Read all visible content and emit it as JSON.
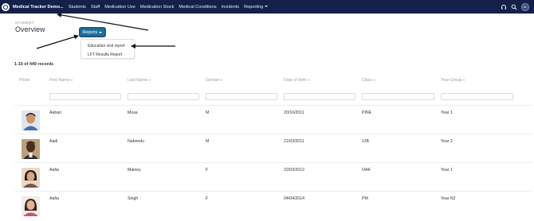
{
  "navbar": {
    "brand": "Medical Tracker Demo...",
    "links": [
      "Students",
      "Staff",
      "Medication Use",
      "Medication Stock",
      "Medical Conditions",
      "Incidents",
      "Reporting"
    ],
    "user_initials": "DL",
    "bg_color": "#13204a"
  },
  "header": {
    "eyebrow": "STUDENT",
    "title": "Overview"
  },
  "reports": {
    "button_label": "Reports",
    "menu_items": [
      "Education visit report",
      "LFT Results Report"
    ]
  },
  "records": {
    "summary": "1-10 of 449 records"
  },
  "table": {
    "columns": [
      "Photo",
      "First Name",
      "Last Name",
      "Gender",
      "Date of birth",
      "Class",
      "Year Group"
    ],
    "rows": [
      {
        "first": "Aaban",
        "last": "Musa",
        "gender": "M",
        "dob": "20/10/2011",
        "class": "PINE",
        "year": "Year 1"
      },
      {
        "first": "Aadi",
        "last": "Nabendu",
        "gender": "M",
        "dob": "21/03/2011",
        "class": "2JB",
        "year": "Year 2"
      },
      {
        "first": "Aafia",
        "last": "Mainey",
        "gender": "F",
        "dob": "22/03/2012",
        "class": "OAK",
        "year": "Year 1"
      },
      {
        "first": "Aafia",
        "last": "Singh",
        "gender": "F",
        "dob": "04/04/2014",
        "class": "PM",
        "year": "Year N2"
      }
    ]
  },
  "colors": {
    "accent": "#1f6f9e",
    "annotation_arrow": "#111111"
  }
}
